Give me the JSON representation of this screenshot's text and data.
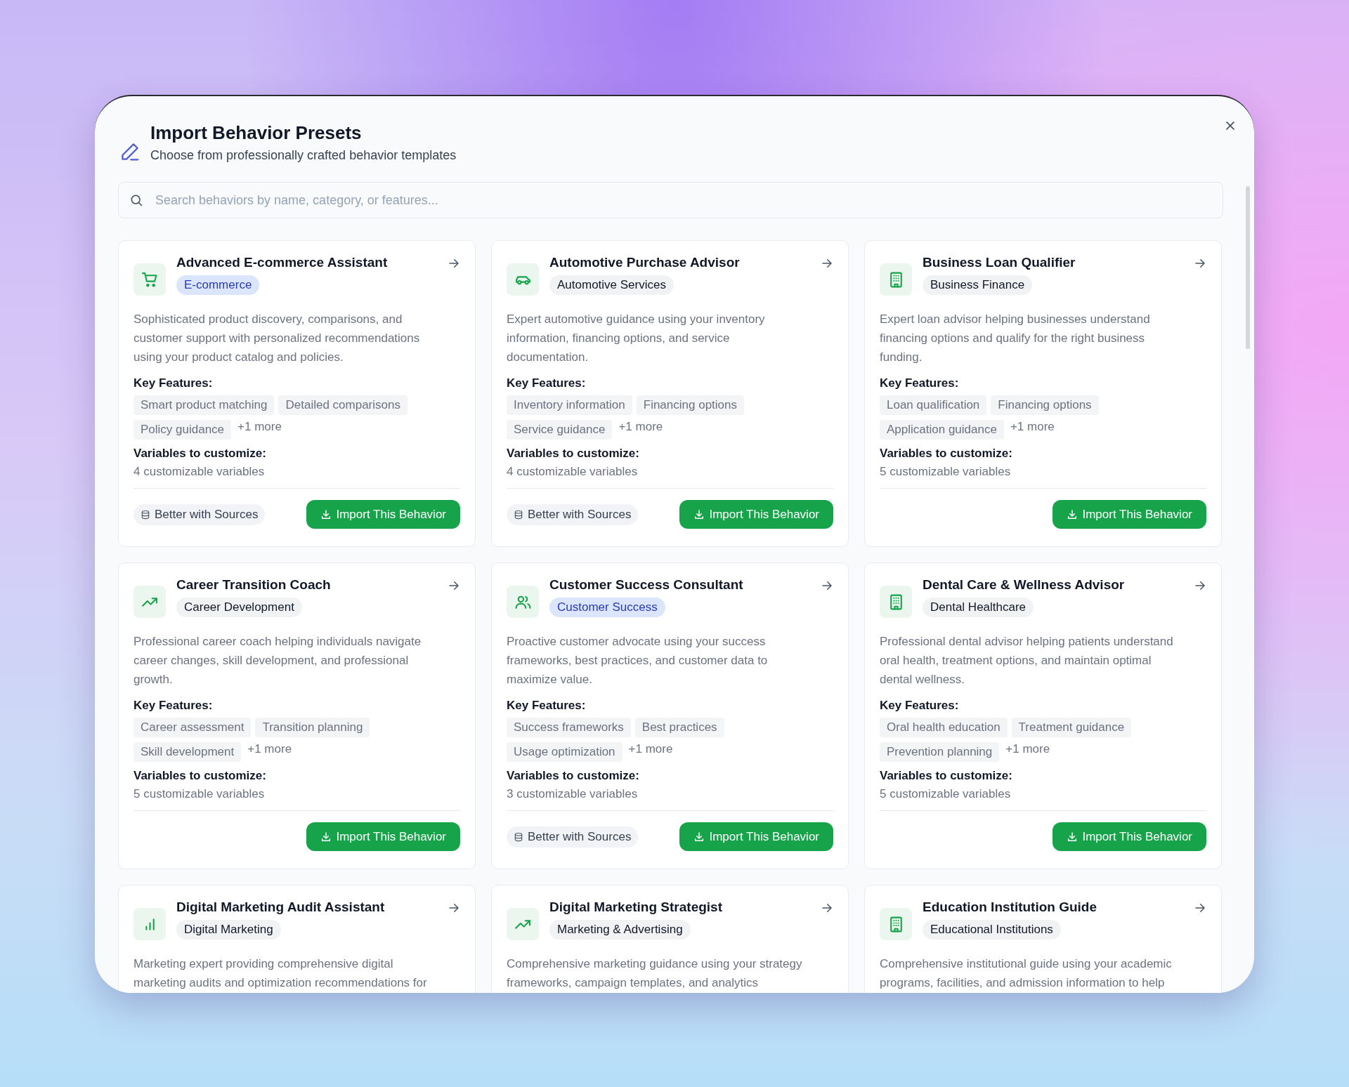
{
  "dialog": {
    "title": "Import Behavior Presets",
    "subtitle": "Choose from professionally crafted behavior templates"
  },
  "search": {
    "placeholder": "Search behaviors by name, category, or features..."
  },
  "cards": [
    {
      "title": "Advanced E-commerce Assistant",
      "category": "E-commerce",
      "highlighted": true,
      "description": "Sophisticated product discovery, comparisons, and customer support with personalized recommendations using your product catalog and policies.",
      "features_label": "Key Features:",
      "features": [
        "Smart product matching",
        "Detailed comparisons",
        "Policy guidance"
      ],
      "more": "+1 more",
      "variables_label": "Variables to customize:",
      "variables": "4 customizable variables",
      "sources": "Better with Sources",
      "button": "Import This Behavior"
    },
    {
      "title": "Automotive Purchase Advisor",
      "category": "Automotive Services",
      "highlighted": false,
      "description": "Expert automotive guidance using your inventory information, financing options, and service documentation.",
      "features_label": "Key Features:",
      "features": [
        "Inventory information",
        "Financing options",
        "Service guidance"
      ],
      "more": "+1 more",
      "variables_label": "Variables to customize:",
      "variables": "4 customizable variables",
      "sources": "Better with Sources",
      "button": "Import This Behavior"
    },
    {
      "title": "Business Loan Qualifier",
      "category": "Business Finance",
      "highlighted": false,
      "description": "Expert loan advisor helping businesses understand financing options and qualify for the right business funding.",
      "features_label": "Key Features:",
      "features": [
        "Loan qualification",
        "Financing options",
        "Application guidance"
      ],
      "more": "+1 more",
      "variables_label": "Variables to customize:",
      "variables": "5 customizable variables",
      "button": "Import This Behavior"
    },
    {
      "title": "Career Transition Coach",
      "category": "Career Development",
      "highlighted": false,
      "description": "Professional career coach helping individuals navigate career changes, skill development, and professional growth.",
      "features_label": "Key Features:",
      "features": [
        "Career assessment",
        "Transition planning",
        "Skill development"
      ],
      "more": "+1 more",
      "variables_label": "Variables to customize:",
      "variables": "5 customizable variables",
      "button": "Import This Behavior"
    },
    {
      "title": "Customer Success Consultant",
      "category": "Customer Success",
      "highlighted": true,
      "description": "Proactive customer advocate using your success frameworks, best practices, and customer data to maximize value.",
      "features_label": "Key Features:",
      "features": [
        "Success frameworks",
        "Best practices",
        "Usage optimization"
      ],
      "more": "+1 more",
      "variables_label": "Variables to customize:",
      "variables": "3 customizable variables",
      "sources": "Better with Sources",
      "button": "Import This Behavior"
    },
    {
      "title": "Dental Care & Wellness Advisor",
      "category": "Dental Healthcare",
      "highlighted": false,
      "description": "Professional dental advisor helping patients understand oral health, treatment options, and maintain optimal dental wellness.",
      "features_label": "Key Features:",
      "features": [
        "Oral health education",
        "Treatment guidance",
        "Prevention planning"
      ],
      "more": "+1 more",
      "variables_label": "Variables to customize:",
      "variables": "5 customizable variables",
      "button": "Import This Behavior"
    },
    {
      "title": "Digital Marketing Audit Assistant",
      "category": "Digital Marketing",
      "highlighted": false,
      "description": "Marketing expert providing comprehensive digital marketing audits and optimization recommendations for"
    },
    {
      "title": "Digital Marketing Strategist",
      "category": "Marketing & Advertising",
      "highlighted": false,
      "description": "Comprehensive marketing guidance using your strategy frameworks, campaign templates, and analytics"
    },
    {
      "title": "Education Institution Guide",
      "category": "Educational Institutions",
      "highlighted": false,
      "description": "Comprehensive institutional guide using your academic programs, facilities, and admission information to help"
    }
  ]
}
